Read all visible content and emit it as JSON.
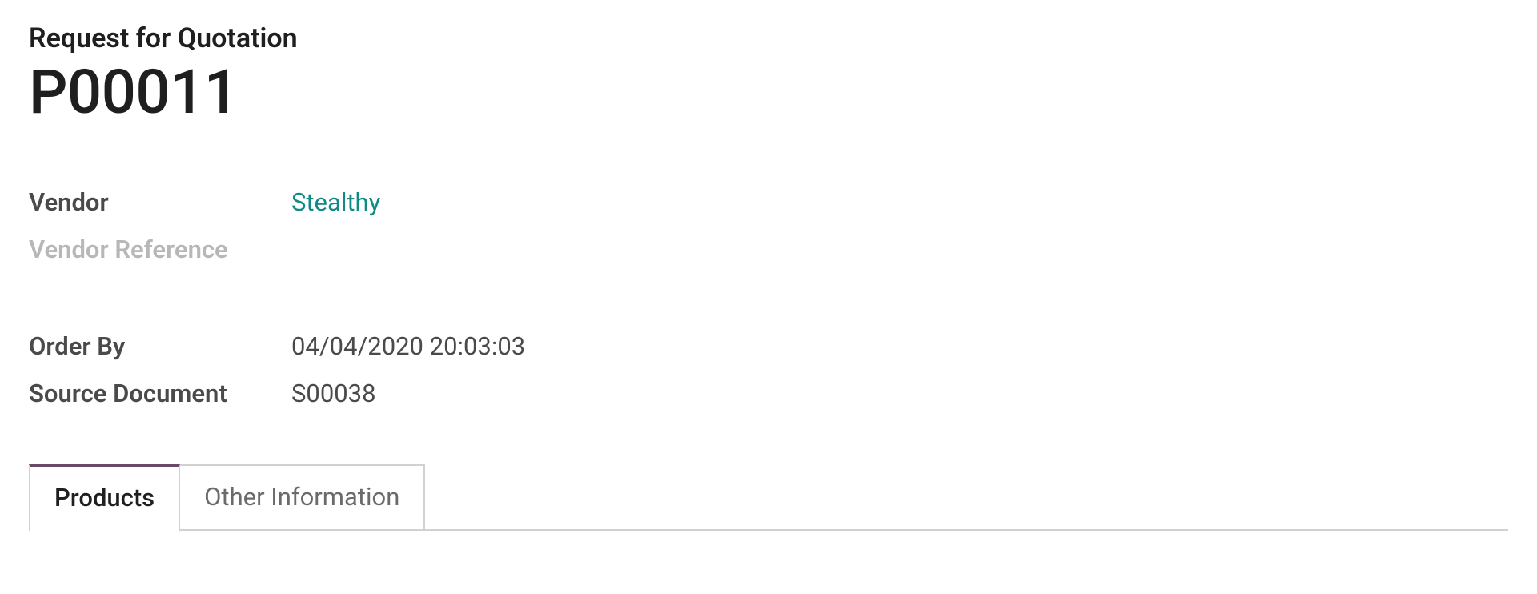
{
  "header": {
    "subtitle": "Request for Quotation",
    "title": "P00011"
  },
  "fields": {
    "vendor": {
      "label": "Vendor",
      "value": "Stealthy"
    },
    "vendor_reference": {
      "label": "Vendor Reference",
      "value": ""
    },
    "order_by": {
      "label": "Order By",
      "value": "04/04/2020 20:03:03"
    },
    "source_document": {
      "label": "Source Document",
      "value": "S00038"
    }
  },
  "tabs": {
    "products": {
      "label": "Products"
    },
    "other_info": {
      "label": "Other Information"
    }
  }
}
